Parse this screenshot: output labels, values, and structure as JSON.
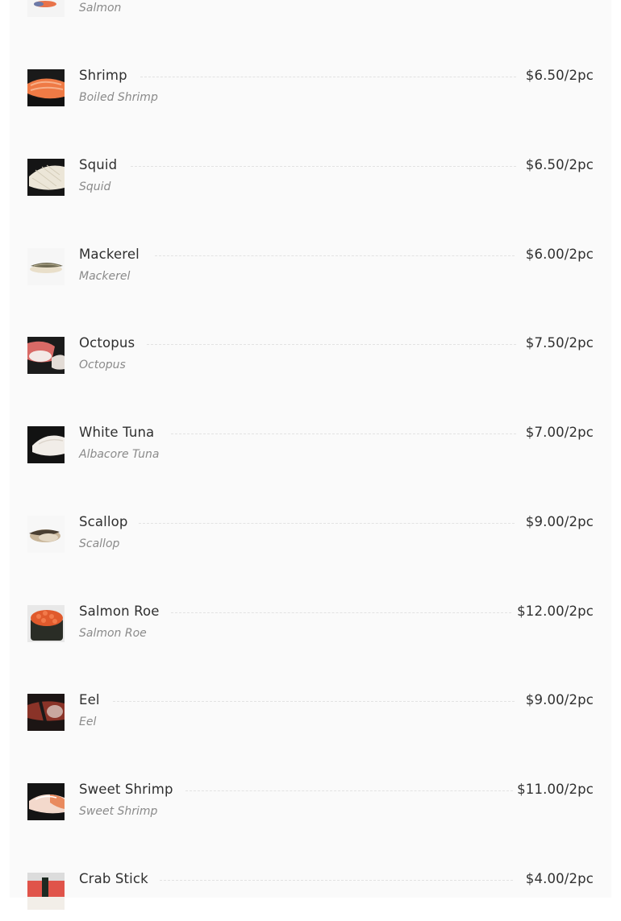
{
  "menu": {
    "items": [
      {
        "name": "",
        "description": "Salmon",
        "price": "",
        "image": "salmon-nigiri-image"
      },
      {
        "name": "Shrimp",
        "description": "Boiled Shrimp",
        "price": "$6.50/2pc",
        "image": "shrimp-nigiri-image"
      },
      {
        "name": "Squid",
        "description": "Squid",
        "price": "$6.50/2pc",
        "image": "squid-nigiri-image"
      },
      {
        "name": "Mackerel",
        "description": "Mackerel",
        "price": "$6.00/2pc",
        "image": "mackerel-nigiri-image"
      },
      {
        "name": "Octopus",
        "description": "Octopus",
        "price": "$7.50/2pc",
        "image": "octopus-nigiri-image"
      },
      {
        "name": "White Tuna",
        "description": "Albacore Tuna",
        "price": "$7.00/2pc",
        "image": "white-tuna-nigiri-image"
      },
      {
        "name": "Scallop",
        "description": "Scallop",
        "price": "$9.00/2pc",
        "image": "scallop-nigiri-image"
      },
      {
        "name": "Salmon Roe",
        "description": "Salmon Roe",
        "price": "$12.00/2pc",
        "image": "salmon-roe-gunkan-image"
      },
      {
        "name": "Eel",
        "description": "Eel",
        "price": "$9.00/2pc",
        "image": "eel-nigiri-image"
      },
      {
        "name": "Sweet Shrimp",
        "description": "Sweet Shrimp",
        "price": "$11.00/2pc",
        "image": "sweet-shrimp-nigiri-image"
      },
      {
        "name": "Crab Stick",
        "description": "",
        "price": "$4.00/2pc",
        "image": "crab-stick-nigiri-image"
      }
    ]
  }
}
